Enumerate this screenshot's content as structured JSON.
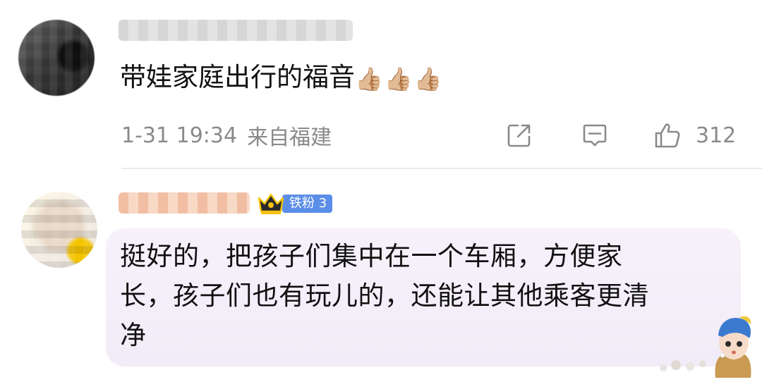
{
  "comments": [
    {
      "text": "带娃家庭出行的福音",
      "emoji": "👍🏼👍🏼👍🏼",
      "time": "1-31 19:34",
      "location": "来自福建",
      "likes": "312"
    },
    {
      "badge": "铁粉 3",
      "text": "挺好的，把孩子们集中在一个车厢，方便家\n长，孩子们也有玩儿的，还能让其他乘客更清\n净"
    }
  ],
  "icons": {
    "share": "share-icon",
    "reply": "comment-icon",
    "like": "thumbs-up-icon",
    "crown": "crown-icon"
  },
  "colors": {
    "meta_text": "#8a8a8a",
    "badge_blue": "#5a8ee8",
    "bubble_bg": "#f4eefa"
  }
}
